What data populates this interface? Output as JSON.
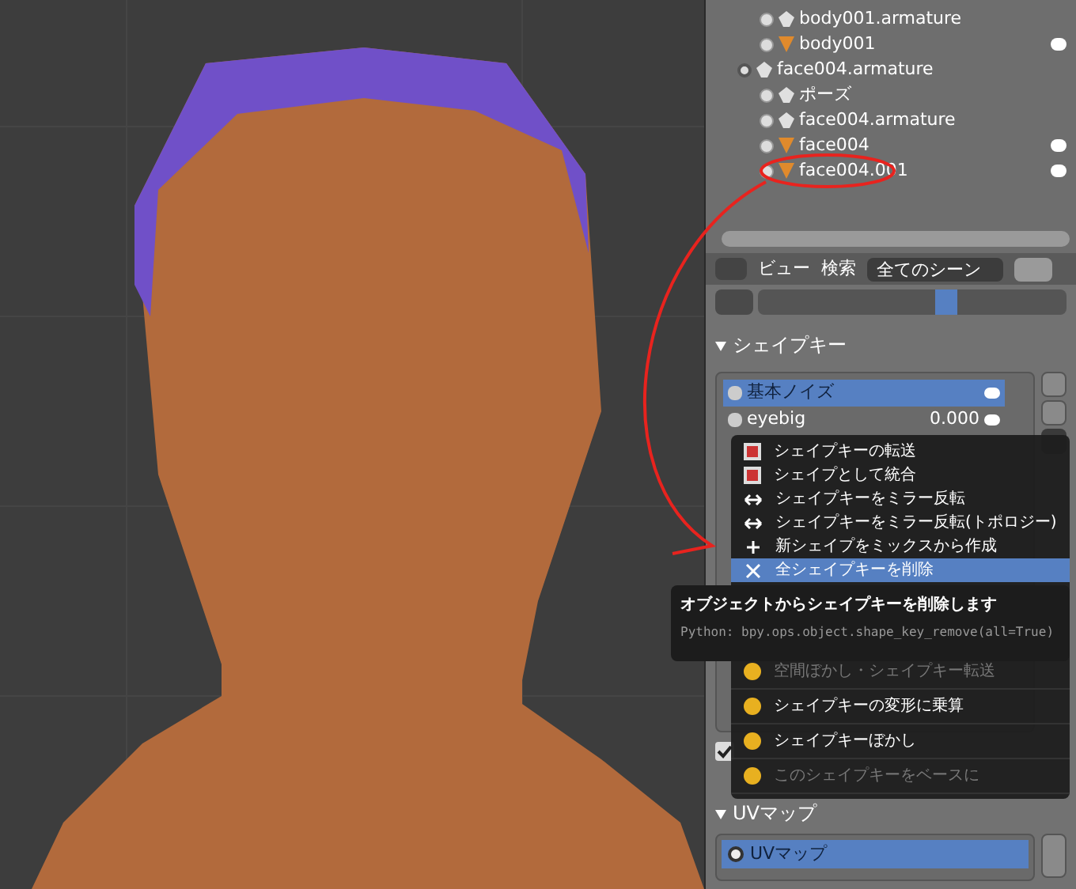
{
  "outliner": {
    "rows": [
      {
        "label": "body001.armature",
        "kind": "armature",
        "expanded": false
      },
      {
        "label": "body001",
        "kind": "mesh",
        "expanded": false
      },
      {
        "label": "face004.armature",
        "kind": "armature",
        "expanded": true,
        "children": [
          {
            "label": "ポーズ",
            "kind": "pose",
            "expanded": false
          },
          {
            "label": "face004.armature",
            "kind": "armature",
            "expanded": false
          },
          {
            "label": "face004",
            "kind": "mesh",
            "expanded": false
          },
          {
            "label": "face004.001",
            "kind": "mesh",
            "expanded": false
          }
        ]
      }
    ]
  },
  "outliner_header": {
    "menus": [
      "ビュー",
      "検索"
    ],
    "scene_filter": "全てのシーン"
  },
  "shape_keys": {
    "title": "シェイプキー",
    "expanded": true,
    "keys": [
      {
        "name": "基本ノイズ",
        "selected": true
      },
      {
        "name": "eyebig",
        "value": "0.000",
        "selected": false
      }
    ],
    "checkbox": {
      "checked": true
    }
  },
  "context_menu": {
    "items": [
      {
        "label": "シェイプキーの転送",
        "kind": "transfer",
        "selected": false,
        "disabled": false
      },
      {
        "label": "シェイプとして統合",
        "kind": "transfer",
        "selected": false,
        "disabled": false
      },
      {
        "label": "シェイプキーをミラー反転",
        "kind": "mirror",
        "selected": false,
        "disabled": false
      },
      {
        "label": "シェイプキーをミラー反転(トポロジー)",
        "kind": "mirror",
        "selected": false,
        "disabled": false
      },
      {
        "label": "新シェイプをミックスから作成",
        "kind": "add",
        "selected": false,
        "disabled": false
      },
      {
        "label": "全シェイプキーを削除",
        "kind": "remove",
        "selected": true,
        "disabled": false
      },
      {
        "label": "空間ぼかし・シェイプキー転送",
        "kind": "addon",
        "selected": false,
        "disabled": true
      },
      {
        "label": "シェイプキーの変形に乗算",
        "kind": "addon",
        "selected": false,
        "disabled": false
      },
      {
        "label": "シェイプキーぼかし",
        "kind": "addon",
        "selected": false,
        "disabled": false
      },
      {
        "label": "このシェイプキーをベースに",
        "kind": "addon",
        "selected": false,
        "disabled": true
      }
    ]
  },
  "tooltip": {
    "title": "オブジェクトからシェイプキーを削除します",
    "python": "Python: bpy.ops.object.shape_key_remove(all=True)"
  },
  "uv_maps": {
    "title": "UVマップ",
    "expanded": true,
    "maps": [
      {
        "name": "UVマップ",
        "selected": true
      }
    ]
  }
}
